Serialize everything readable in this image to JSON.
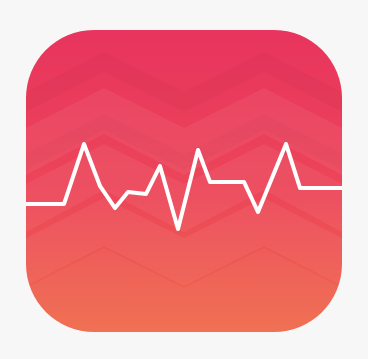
{
  "icon": {
    "name": "heart-rate-app-icon",
    "colors": {
      "background": "#f7f7f7",
      "top": "#e8345e",
      "middle": "#ec4658",
      "bottom": "#f06a4a",
      "line": "#ffffff"
    }
  }
}
